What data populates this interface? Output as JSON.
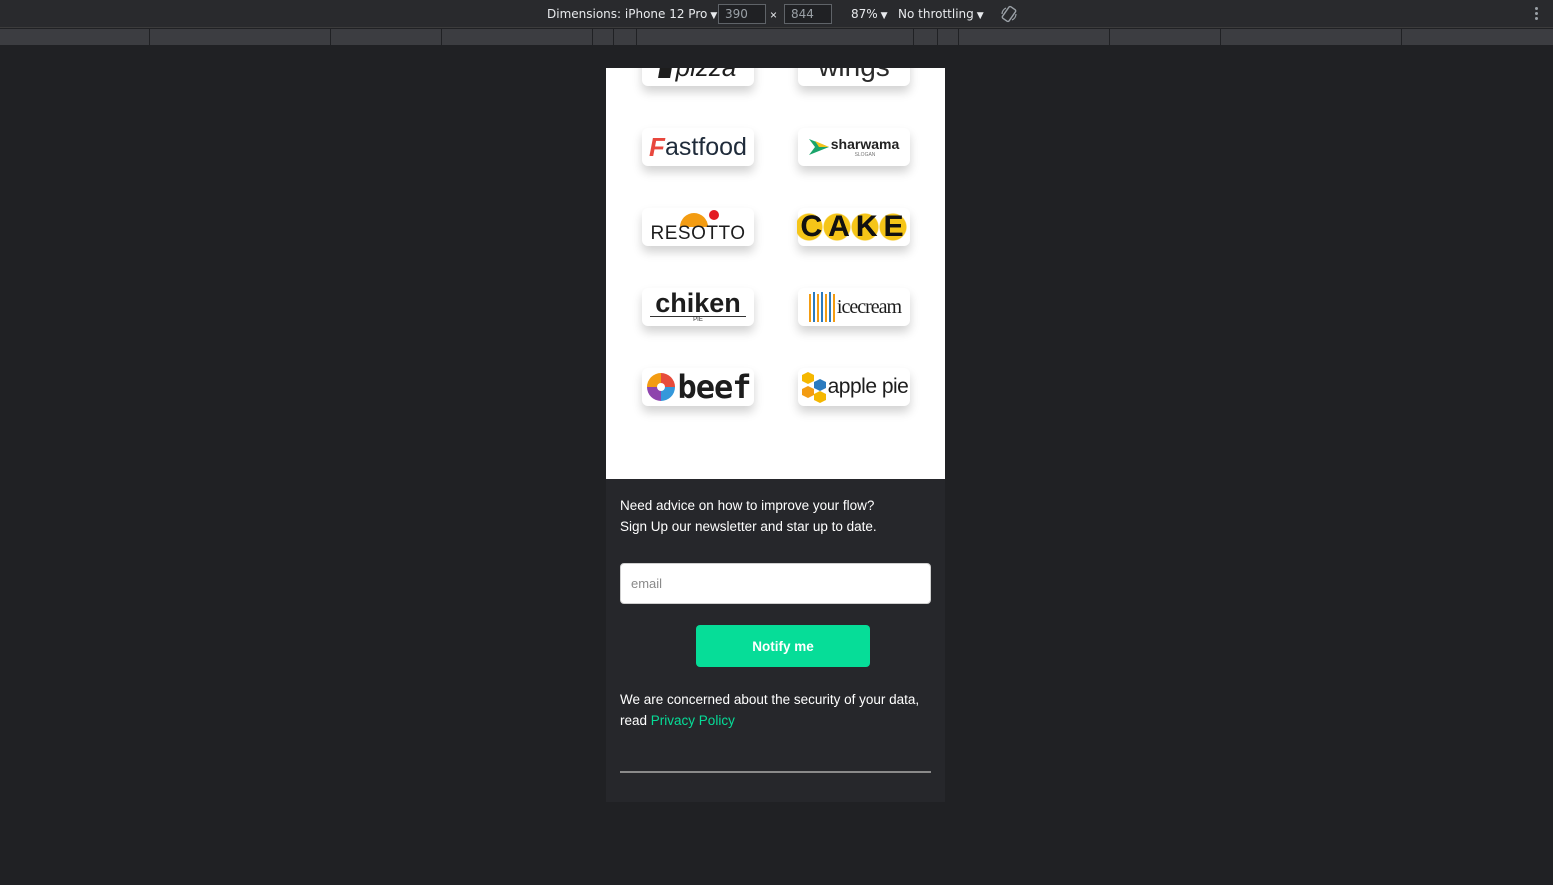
{
  "devtools": {
    "dimensions_label": "Dimensions: iPhone 12 Pro",
    "width_value": "390",
    "times": "×",
    "height_value": "844",
    "zoom": "87%",
    "throttling": "No throttling"
  },
  "logos": [
    {
      "name": "pizza",
      "text": "pizza"
    },
    {
      "name": "wings",
      "text": "wings"
    },
    {
      "name": "fastfood",
      "text": "astfood",
      "mark": "F"
    },
    {
      "name": "sharwama",
      "text": "sharwama",
      "sub": "SLOGAN"
    },
    {
      "name": "resotto",
      "text": "RESOTTO"
    },
    {
      "name": "cake",
      "text": "CAKE"
    },
    {
      "name": "chiken",
      "text": "chiken",
      "sub": "PIE"
    },
    {
      "name": "icecream",
      "text": "icecream"
    },
    {
      "name": "beef",
      "text": "beef"
    },
    {
      "name": "apple-pie",
      "text": "apple pie"
    }
  ],
  "newsletter": {
    "line1": "Need advice on how to improve your flow?",
    "line2": "Sign Up our newsletter and star up to date.",
    "email_placeholder": "email",
    "button_label": "Notify me",
    "privacy_prefix": "We are concerned about the security of your data, read",
    "privacy_link": "Privacy Policy"
  },
  "colors": {
    "accent": "#06dd98",
    "footer_bg": "#26272b",
    "page_bg": "#202124"
  }
}
